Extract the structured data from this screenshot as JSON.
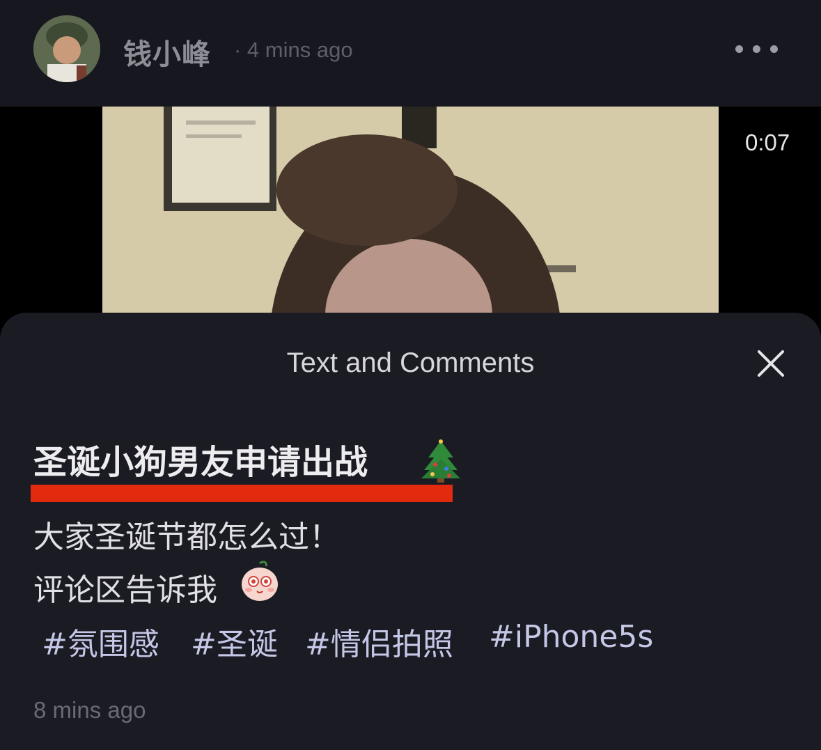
{
  "header": {
    "author_name": "钱小峰",
    "time_ago": "· 4 mins ago"
  },
  "video": {
    "duration": "0:07"
  },
  "sheet": {
    "title": "Text and Comments"
  },
  "post": {
    "title": "圣诞小狗男友申请出战",
    "title_emoji": "christmas-tree-icon",
    "lines": [
      "大家圣诞节都怎么过！",
      "评论区告诉我"
    ],
    "line_emoji": "shy-face-emoji-icon",
    "hashtags": [
      "#氛围感",
      "#圣诞",
      "#情侣拍照",
      "#iPhone5s"
    ],
    "time_ago": "8 mins ago"
  },
  "colors": {
    "background": "#000000",
    "panel": "#1b1b24",
    "header": "#17171f",
    "underline_highlight": "#e22a0f",
    "hashtag": "#c4c7e6"
  }
}
